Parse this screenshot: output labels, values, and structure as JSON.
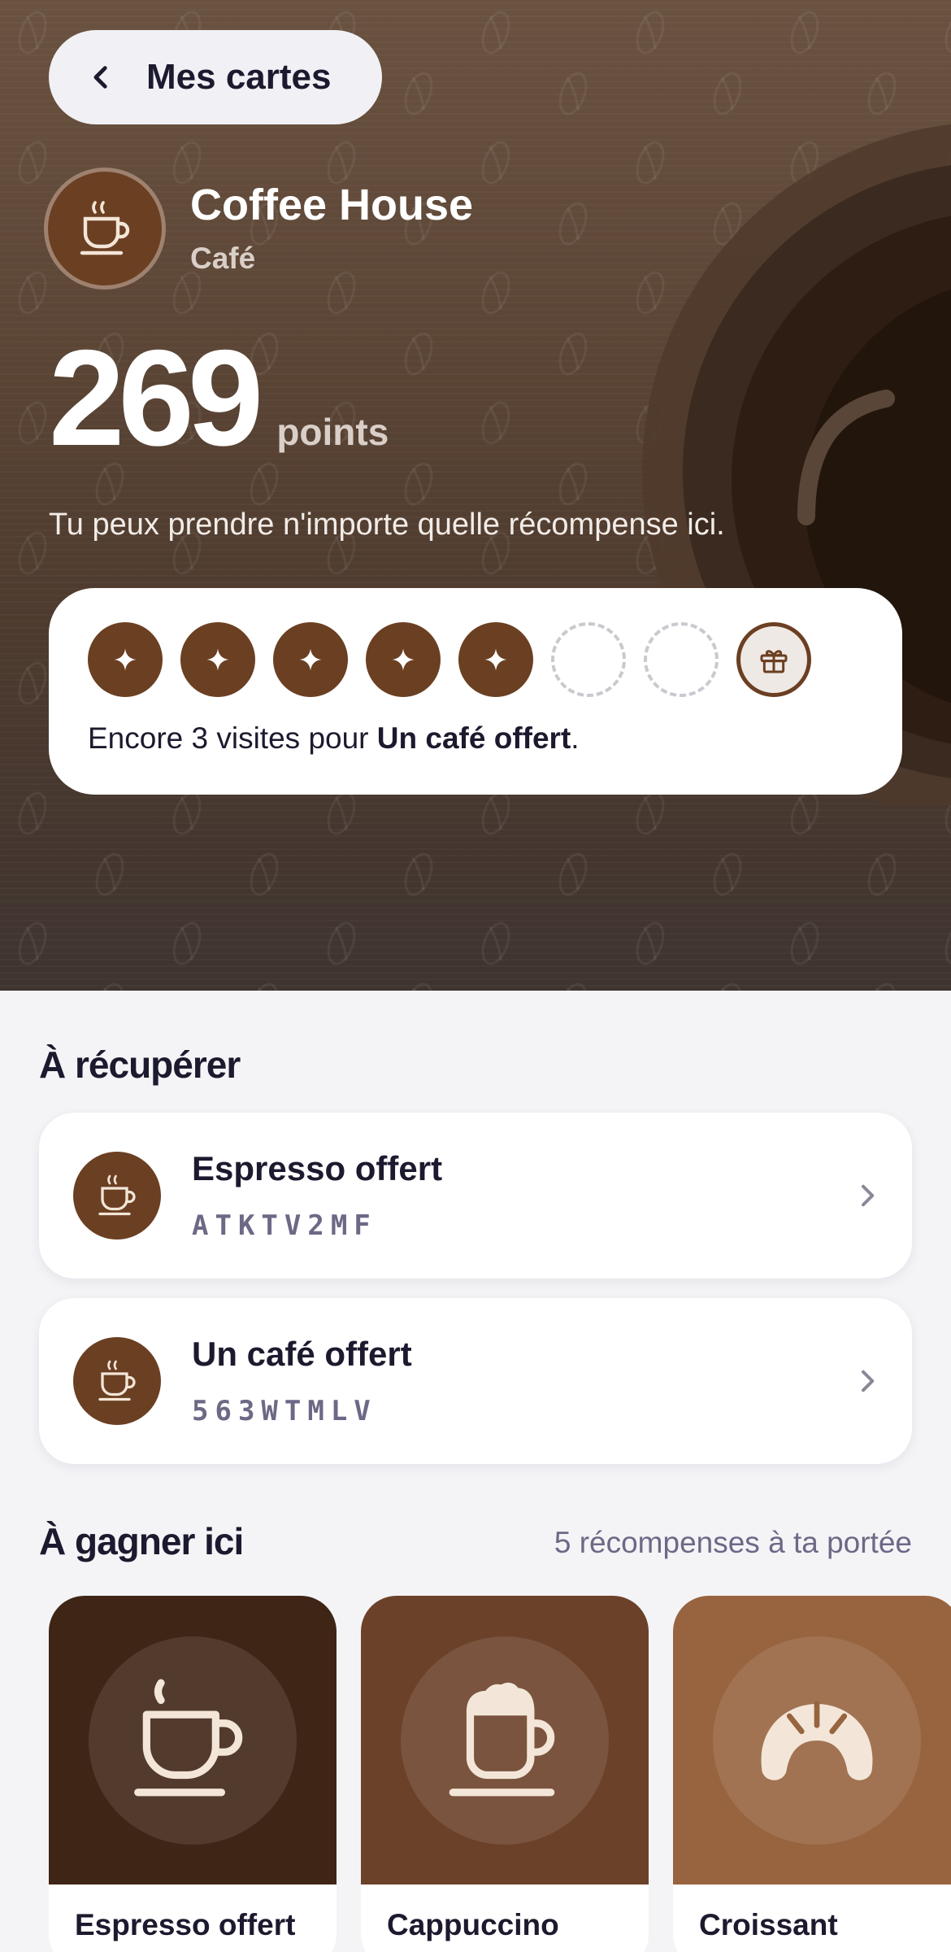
{
  "header": {
    "back_label": "Mes cartes"
  },
  "brand": {
    "name": "Coffee House",
    "category": "Café"
  },
  "points": {
    "value": "269",
    "unit": "points"
  },
  "hint": "Tu peux prendre n'importe quelle récompense ici.",
  "stamp_card": {
    "filled": 5,
    "total": 7,
    "prefix": "Encore 3 visites pour ",
    "reward": "Un café offert",
    "suffix": "."
  },
  "redeem": {
    "title": "À récupérer",
    "items": [
      {
        "name": "Espresso offert",
        "code": "ATKTV2MF"
      },
      {
        "name": "Un café offert",
        "code": "563WTMLV"
      }
    ]
  },
  "earn": {
    "title": "À gagner ici",
    "subtitle": "5 récompenses à ta portée",
    "items": [
      {
        "name": "Espresso offert",
        "icon": "espresso-cup-icon",
        "color": "#3f2516"
      },
      {
        "name": "Cappuccino offert",
        "icon": "cappuccino-cup-icon",
        "color": "#6b4129"
      },
      {
        "name": "Croissant gratuit",
        "icon": "croissant-icon",
        "color": "#97643f"
      }
    ]
  },
  "colors": {
    "brand_brown": "#6b3f22",
    "text_dark": "#1c1a2e",
    "muted": "#6e6886"
  }
}
